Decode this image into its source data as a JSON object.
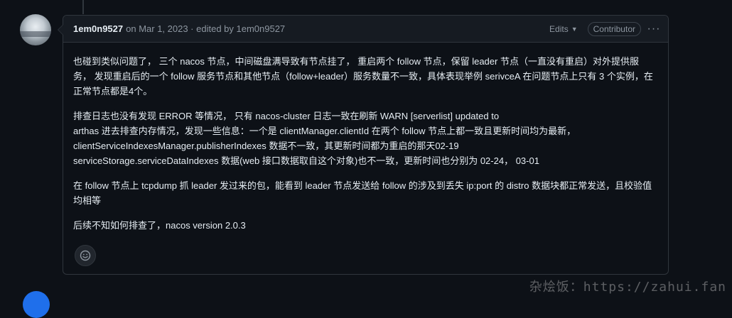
{
  "comment": {
    "author": "1em0n9527",
    "meta": "on Mar 1, 2023 · edited by 1em0n9527",
    "edits_label": "Edits",
    "badge": "Contributor",
    "paragraphs": [
      [
        "也碰到类似问题了， 三个 nacos 节点，中间磁盘满导致有节点挂了， 重启两个 follow 节点，保留 leader 节点（一直没有重启）对外提供服务， 发现重启后的一个 follow 服务节点和其他节点（follow+leader）服务数量不一致，具体表现举例 serivceA 在问题节点上只有 3 个实例，在正常节点都是4个。"
      ],
      [
        "排查日志也没有发现 ERROR 等情况， 只有 nacos-cluster 日志一致在刷新 WARN [serverlist] updated to",
        "arthas 进去排查内存情况，发现一些信息：一个是 clientManager.clientId 在两个 follow 节点上都一致且更新时间均为最新，",
        "clientServiceIndexesManager.publisherIndexes 数据不一致，其更新时间都为重启的那天02-19",
        "serviceStorage.serviceDataIndexes 数据(web 接口数据取自这个对象)也不一致，更新时间也分别为 02-24， 03-01"
      ],
      [
        "在 follow 节点上 tcpdump 抓 leader 发过来的包，能看到 leader 节点发送给 follow 的涉及到丢失 ip:port 的 distro 数据块都正常发送，且校验值均相等"
      ],
      [
        "后续不知如何排查了，nacos version 2.0.3"
      ]
    ]
  },
  "watermark": "杂烩饭：https://zahui.fan"
}
